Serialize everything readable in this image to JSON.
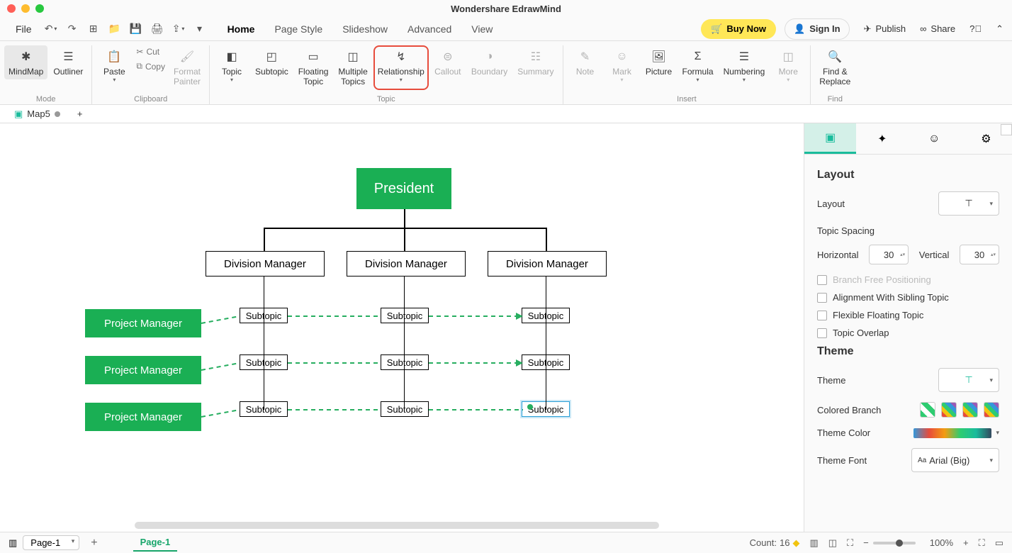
{
  "app": {
    "title": "Wondershare EdrawMind"
  },
  "menu": {
    "file": "File",
    "tabs": [
      "Home",
      "Page Style",
      "Slideshow",
      "Advanced",
      "View"
    ],
    "active_tab": "Home",
    "buy_now": "Buy Now",
    "sign_in": "Sign In",
    "publish": "Publish",
    "share": "Share"
  },
  "ribbon": {
    "mode": {
      "label": "Mode",
      "items": [
        "MindMap",
        "Outliner"
      ]
    },
    "clipboard": {
      "label": "Clipboard",
      "paste": "Paste",
      "cut": "Cut",
      "copy": "Copy",
      "format_painter": "Format\nPainter"
    },
    "topic": {
      "label": "Topic",
      "items": [
        "Topic",
        "Subtopic",
        "Floating\nTopic",
        "Multiple\nTopics",
        "Relationship",
        "Callout",
        "Boundary",
        "Summary"
      ]
    },
    "insert": {
      "label": "Insert",
      "items": [
        "Note",
        "Mark",
        "Picture",
        "Formula",
        "Numbering",
        "More"
      ]
    },
    "find": {
      "label": "Find",
      "find_replace": "Find &\nReplace"
    }
  },
  "doc_tabs": {
    "tab1": "Map5"
  },
  "diagram": {
    "root": "President",
    "div_mgr": "Division Manager",
    "pm": "Project Manager",
    "subtopic": "Subtopic"
  },
  "sidebar": {
    "section_layout": "Layout",
    "layout_label": "Layout",
    "topic_spacing": "Topic Spacing",
    "horizontal": "Horizontal",
    "h_val": "30",
    "vertical": "Vertical",
    "v_val": "30",
    "branch_free": "Branch Free Positioning",
    "alignment": "Alignment With Sibling Topic",
    "flexible": "Flexible Floating Topic",
    "overlap": "Topic Overlap",
    "section_theme": "Theme",
    "theme_label": "Theme",
    "colored_branch": "Colored Branch",
    "theme_color": "Theme Color",
    "theme_font": "Theme Font",
    "font_val": "Arial (Big)"
  },
  "status": {
    "page_sel": "Page-1",
    "page_tab": "Page-1",
    "count_label": "Count:",
    "count_val": "16",
    "zoom": "100%"
  }
}
